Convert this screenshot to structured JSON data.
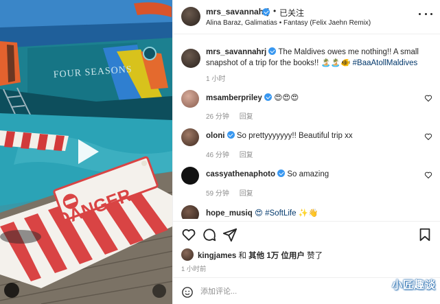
{
  "media": {
    "boat_text": "FOUR SEASONS",
    "dock_text": "DANGER"
  },
  "header": {
    "username": "mrs_savannahrj",
    "dot": "•",
    "follow_label": "已关注",
    "song": "Alina Baraz, Galimatias • Fantasy (Felix Jaehn Remix)"
  },
  "caption": {
    "username": "mrs_savannahrj",
    "text": " The Maldives owes me nothing!! A small snapshot of a trip for the books!! 🏝️🏝️🐠 ",
    "hashtag": "#BaaAtollMaldives",
    "time": "1 小时"
  },
  "comments": [
    {
      "username": "msamberpriley",
      "text": "😍😍😍",
      "time": "26 分钟",
      "likes": "回复",
      "avatar_color": "#b98a7a"
    },
    {
      "username": "oloni",
      "text": "So prettyyyyyyy!! Beautiful trip xx",
      "time": "46 分钟",
      "likes": "回复",
      "avatar_color": "#6a4a3a"
    },
    {
      "username": "cassyathenaphoto",
      "text": "So amazing",
      "time": "59 分钟",
      "likes": "回复",
      "avatar_color": "#111111"
    },
    {
      "username": "hope_musiq",
      "text": "😍 #SoftLife ✨👋",
      "time": "",
      "likes": "",
      "avatar_color": "#3a2a22"
    }
  ],
  "likes": {
    "username": "kingjames",
    "middle": " 和 ",
    "others": "其他 1万 位用户",
    "suffix": " 赞了"
  },
  "post_time": "1 小时前",
  "comment_box": {
    "placeholder": "添加评论..."
  },
  "watermark": "小匠趣谈",
  "colors": {
    "link": "#00376b",
    "verified": "#3897f0",
    "muted": "#8e8e8e",
    "water": "#1a8fa8",
    "boat_hull": "#0e5f6e"
  }
}
